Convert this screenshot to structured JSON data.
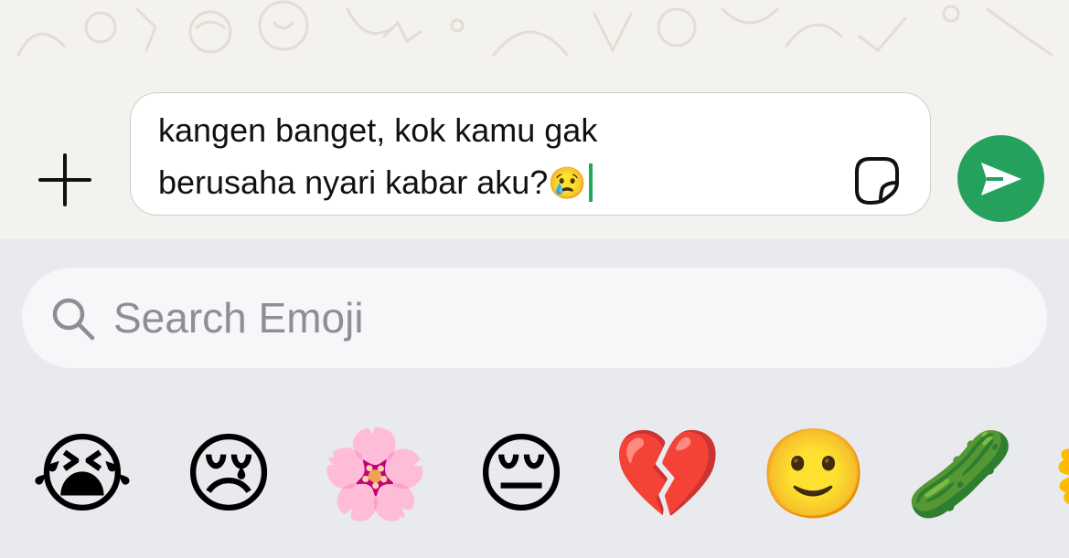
{
  "composer": {
    "plus_icon": "plus-icon",
    "message_line1": "kangen banget, kok kamu gak",
    "message_line2": "berusaha nyari kabar aku?",
    "message_emoji": "😢",
    "sticker_icon": "sticker-icon",
    "send_icon": "send-icon"
  },
  "search": {
    "placeholder": "Search Emoji",
    "icon": "search-icon"
  },
  "emoji_suggestions": [
    "😭",
    "😢",
    "🌸",
    "😔",
    "💔",
    "🙂",
    "🥒",
    "🌼"
  ],
  "colors": {
    "accent": "#25a15e",
    "caret": "#1faa59",
    "keyboard_bg": "#e9eaed",
    "wallpaper_bg": "#f4f2ee"
  }
}
